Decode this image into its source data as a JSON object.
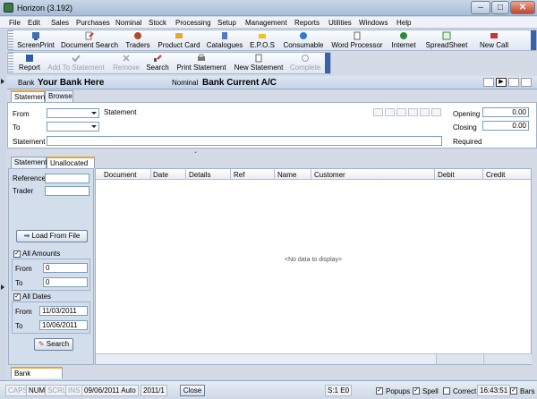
{
  "window": {
    "title": "Horizon (3.192)",
    "btn_min": "–",
    "btn_max": "□",
    "btn_close": "✕"
  },
  "menu": [
    "File",
    "Edit",
    "Sales",
    "Purchases",
    "Nominal",
    "Stock",
    "Processing",
    "Setup",
    "Management",
    "Reports",
    "Utilities",
    "Windows",
    "Help"
  ],
  "toolbar1": [
    {
      "label": "ScreenPrint",
      "icon": "screenprint-icon"
    },
    {
      "label": "Document Search",
      "icon": "document-search-icon"
    },
    {
      "label": "Traders",
      "icon": "traders-icon"
    },
    {
      "label": "Product Card",
      "icon": "product-card-icon"
    },
    {
      "label": "Catalogues",
      "icon": "catalogues-icon"
    },
    {
      "label": "E.P.O.S",
      "icon": "epos-icon"
    },
    {
      "label": "Consumable",
      "icon": "consumable-icon"
    },
    {
      "label": "Word Processor",
      "icon": "word-processor-icon"
    },
    {
      "label": "Internet",
      "icon": "internet-icon"
    },
    {
      "label": "SpreadSheet",
      "icon": "spreadsheet-icon"
    },
    {
      "label": "New Call",
      "icon": "new-call-icon"
    }
  ],
  "toolbar2": [
    {
      "label": "Report",
      "icon": "report-icon",
      "disabled": false
    },
    {
      "label": "Add To Statement",
      "icon": "check-icon",
      "disabled": true
    },
    {
      "label": "Remove",
      "icon": "remove-icon",
      "disabled": true
    },
    {
      "label": "Search",
      "icon": "search-icon",
      "disabled": false
    },
    {
      "label": "Print Statement",
      "icon": "printer-icon",
      "disabled": false
    },
    {
      "label": "New Statement",
      "icon": "new-statement-icon",
      "disabled": false
    },
    {
      "label": "Complete",
      "icon": "complete-icon",
      "disabled": true
    }
  ],
  "bankbar": {
    "bank_label": "Bank",
    "bank_value": "Your Bank Here",
    "nominal_label": "Nominal",
    "nominal_value": "Bank Current A/C"
  },
  "top_tabs": [
    "Statement",
    "Browse"
  ],
  "statement_form": {
    "from_label": "From",
    "to_label": "To",
    "statement_label": "Statement",
    "statement_inline_label": "Statement",
    "opening_label": "Opening",
    "opening_value": "0.00",
    "closing_label": "Closing",
    "closing_value": "0.00",
    "required_label": "Required"
  },
  "lower_tabs": [
    "Statement",
    "Unallocated"
  ],
  "filter": {
    "reference_label": "Reference",
    "trader_label": "Trader",
    "load_button": "Load From File",
    "all_amounts_label": "All Amounts",
    "from_label": "From",
    "to_label": "To",
    "amount_from": "0",
    "amount_to": "0",
    "all_dates_label": "All Dates",
    "date_from": "11/03/2011",
    "date_to": "10/06/2011",
    "search_button": "Search"
  },
  "grid": {
    "columns": [
      "Document",
      "Date",
      "Details",
      "Ref",
      "Name",
      "Customer",
      "Debit",
      "Credit"
    ],
    "empty_text": "<No data to display>"
  },
  "bottom_tab": "Bank Reconcile",
  "status": {
    "caps": "CAPS",
    "num": "NUM",
    "scrl": "SCRL",
    "ins": "INS",
    "date": "09/06/2011 Auto",
    "period": "2011/1",
    "close": "Close",
    "s": "S:1 E0",
    "popups": "Popups",
    "spell": "Spell",
    "correct": "Correct",
    "time": "16:43:51",
    "bars": "Bars"
  },
  "colors": {
    "accent_tab": "#e8a23a",
    "toolbar_cap": "#3a62a8"
  }
}
